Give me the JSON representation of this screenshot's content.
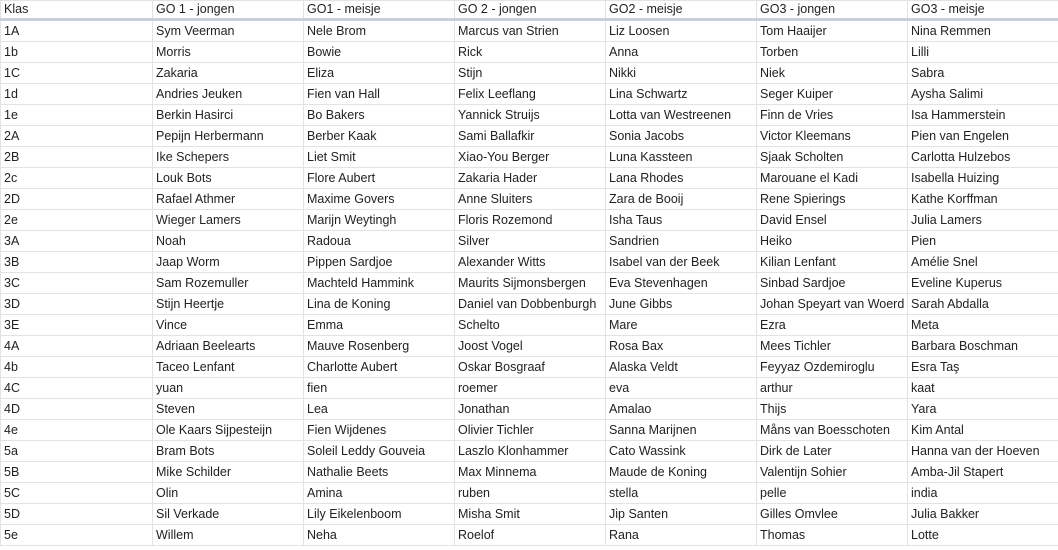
{
  "headers": [
    "Klas",
    "GO 1 - jongen",
    "GO1 - meisje",
    "GO 2 - jongen",
    "GO2 - meisje",
    "GO3 -  jongen",
    "GO3 - meisje"
  ],
  "rows": [
    [
      "1A",
      "Sym Veerman",
      "Nele Brom",
      "Marcus van Strien",
      "Liz Loosen",
      "Tom Haaijer",
      "Nina Remmen"
    ],
    [
      "1b",
      "Morris",
      "Bowie",
      "Rick",
      "Anna",
      "Torben",
      "Lilli"
    ],
    [
      "1C",
      "Zakaria",
      "Eliza",
      "Stijn",
      "Nikki",
      "Niek",
      "Sabra"
    ],
    [
      "1d",
      "Andries Jeuken",
      "Fien van Hall",
      "Felix Leeflang",
      "Lina Schwartz",
      "Seger Kuiper",
      "Aysha Salimi"
    ],
    [
      "1e",
      "Berkin Hasirci",
      "Bo Bakers",
      "Yannick Struijs",
      "Lotta van Westreenen",
      "Finn de Vries",
      "Isa Hammerstein"
    ],
    [
      "2A",
      "Pepijn Herbermann",
      "Berber Kaak",
      "Sami Ballafkir",
      "Sonia Jacobs",
      "Victor Kleemans",
      "Pien van Engelen"
    ],
    [
      "2B",
      "Ike Schepers",
      "Liet Smit",
      "Xiao-You Berger",
      "Luna Kassteen",
      "Sjaak Scholten",
      "Carlotta Hulzebos"
    ],
    [
      "2c",
      "Louk Bots",
      "Flore Aubert",
      "Zakaria Hader",
      "Lana Rhodes",
      "Marouane el Kadi",
      "Isabella Huizing"
    ],
    [
      "2D",
      "Rafael Athmer",
      "Maxime Govers",
      "Anne Sluiters",
      "Zara de Booij",
      "Rene Spierings",
      "Kathe Korffman"
    ],
    [
      "2e",
      "Wieger Lamers",
      "Marijn Weytingh",
      "Floris Rozemond",
      "Isha Taus",
      "David Ensel",
      "Julia Lamers"
    ],
    [
      "3A",
      "Noah",
      "Radoua",
      "Silver",
      "Sandrien",
      "Heiko",
      "Pien"
    ],
    [
      "3B",
      "Jaap Worm",
      "Pippen Sardjoe",
      "Alexander Witts",
      "Isabel van der Beek",
      "Kilian Lenfant",
      "Amélie Snel"
    ],
    [
      "3C",
      "Sam Rozemuller",
      "Machteld Hammink",
      "Maurits Sijmonsbergen",
      "Eva Stevenhagen",
      "Sinbad Sardjoe",
      "Eveline Kuperus"
    ],
    [
      "3D",
      "Stijn Heertje",
      "Lina de Koning",
      "Daniel van Dobbenburgh",
      "June Gibbs",
      "Johan Speyart van Woerd",
      "Sarah Abdalla"
    ],
    [
      "3E",
      "Vince",
      "Emma",
      "Schelto",
      "Mare",
      "Ezra",
      "Meta"
    ],
    [
      "4A",
      "Adriaan Beelearts",
      "Mauve Rosenberg",
      "Joost Vogel",
      "Rosa Bax",
      "Mees Tichler",
      "Barbara Boschman"
    ],
    [
      "4b",
      "Taceo Lenfant",
      "Charlotte Aubert",
      "Oskar Bosgraaf",
      "Alaska Veldt",
      "Feyyaz Ozdemiroglu",
      "Esra Taş"
    ],
    [
      "4C",
      "yuan",
      "fien",
      "roemer",
      "eva",
      "arthur",
      "kaat"
    ],
    [
      "4D",
      "Steven",
      "Lea",
      "Jonathan",
      "Amalao",
      "Thijs",
      "Yara"
    ],
    [
      "4e",
      "Ole Kaars Sijpesteijn",
      "Fien Wijdenes",
      "Olivier Tichler",
      "Sanna Marijnen",
      "Måns van Boesschoten",
      "Kim Antal"
    ],
    [
      "5a",
      "Bram Bots",
      "Soleil Leddy Gouveia",
      "Laszlo Klonhammer",
      "Cato Wassink",
      "Dirk de Later",
      "Hanna van der Hoeven"
    ],
    [
      "5B",
      "Mike Schilder",
      "Nathalie Beets",
      "Max Minnema",
      "Maude de Koning",
      " Valentijn Sohier",
      "Amba-Jil Stapert"
    ],
    [
      "5C",
      "Olin",
      "Amina",
      "ruben",
      "stella",
      "pelle",
      "india"
    ],
    [
      "5D",
      "Sil Verkade",
      "Lily Eikelenboom",
      "Misha Smit",
      "Jip Santen",
      "Gilles Omvlee",
      "Julia Bakker"
    ],
    [
      "5e",
      "Willem",
      "Neha",
      "Roelof",
      "Rana",
      "Thomas",
      "Lotte"
    ]
  ]
}
